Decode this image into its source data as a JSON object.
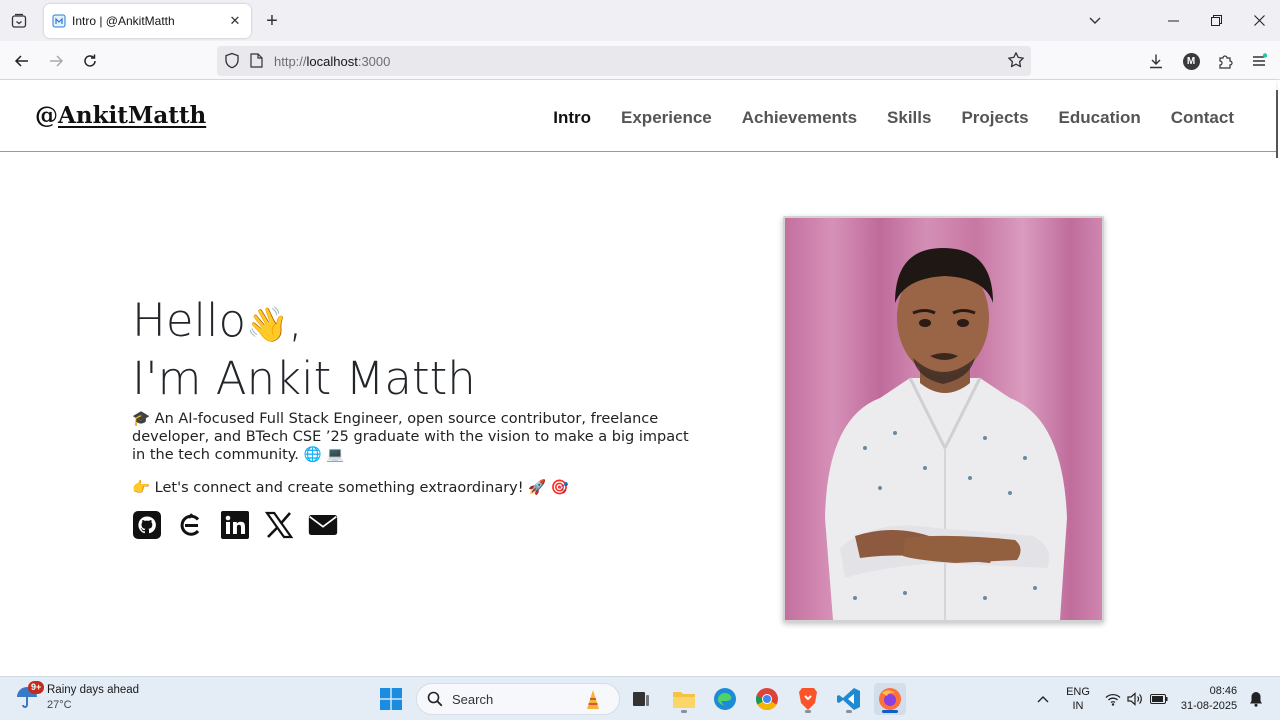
{
  "browser": {
    "tab_title": "Intro | @AnkitMatth",
    "url_prefix": "http://",
    "url_host": "localhost",
    "url_port": ":3000",
    "profile_initial": "M"
  },
  "site": {
    "logo_at": "@",
    "logo_name": "AnkitMatth",
    "nav": [
      "Intro",
      "Experience",
      "Achievements",
      "Skills",
      "Projects",
      "Education",
      "Contact"
    ],
    "active_nav": "Intro"
  },
  "hero": {
    "hello": "Hello",
    "wave_emoji": "👋",
    "comma": ",",
    "name_line": "I'm Ankit Matth",
    "bio": "🎓 An AI-focused Full Stack Engineer, open source contributor, freelance developer, and BTech CSE ’25 graduate with the vision to make a big impact in the tech community. 🌐 💻",
    "cta": "👉 Let's connect and create something extraordinary! 🚀 🎯",
    "socials": [
      "github-icon",
      "hashnode-icon",
      "linkedin-icon",
      "x-icon",
      "email-icon"
    ]
  },
  "taskbar": {
    "weather_title": "Rainy days ahead",
    "weather_temp": "27°C",
    "weather_badge": "9+",
    "search_label": "Search",
    "lang_top": "ENG",
    "lang_bottom": "IN",
    "time": "08:46",
    "date": "31-08-2025"
  },
  "colors": {
    "photo_background": "#c77aa6",
    "taskbar_bg": "#e4ecf6",
    "active_indicator": "#0a5fc8"
  }
}
